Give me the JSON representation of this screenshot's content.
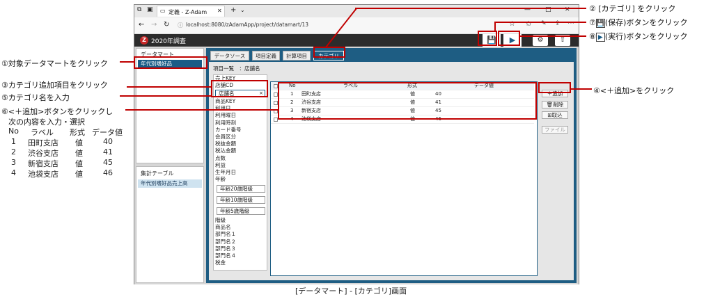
{
  "browser": {
    "tab_title": "定義 - Z-Adam",
    "url": "localhost:8080/zAdamApp/project/datamart/13"
  },
  "app": {
    "title": "2020年調査"
  },
  "sidebar": {
    "header": "データマート",
    "items": [
      "年代別嗜好品"
    ],
    "table_header": "集計テーブル",
    "table_items": [
      "年代別嗜好品売上高"
    ]
  },
  "tabs": [
    "データソース",
    "項目定義",
    "計算項目",
    "カテゴリ"
  ],
  "item_list": {
    "header": "項目一覧　：店舗名",
    "items": [
      "売上KEY",
      "店舗CD"
    ],
    "input_value": "店舗名",
    "items_after": [
      "商品KEY",
      "利用日",
      "利用曜日",
      "利用時刻",
      "カード番号",
      "会員区分",
      "税抜金額",
      "税込金額",
      "点数",
      "利益",
      "生年月日",
      "年齢"
    ],
    "sub_items": [
      "年齢20歳階級",
      "年齢10歳階級",
      "年齢5歳階級"
    ],
    "items_tail": [
      "階級",
      "商品名",
      "部門名１",
      "部門名２",
      "部門名３",
      "部門名４",
      "税金"
    ]
  },
  "grid": {
    "columns": [
      "No",
      "ラベル",
      "形式",
      "データ値"
    ],
    "rows": [
      {
        "no": "1",
        "label": "田町支店",
        "type": "値",
        "value": "40"
      },
      {
        "no": "2",
        "label": "渋谷支店",
        "type": "値",
        "value": "41"
      },
      {
        "no": "3",
        "label": "新宿支店",
        "type": "値",
        "value": "45"
      },
      {
        "no": "4",
        "label": "池袋支店",
        "type": "値",
        "value": "46"
      }
    ]
  },
  "buttons": {
    "add": "追加",
    "delete": "削除",
    "import": "取込",
    "file": "ファイル"
  },
  "callouts": {
    "c1": "①対象データマートをクリック",
    "c2": "② [カテゴリ] をクリック",
    "c3": "③カテゴリ追加項目をクリック",
    "c4": "④<＋追加>をクリック",
    "c5": "⑤カテゴリ名を入力",
    "c6a": "⑥<＋追加>ボタンをクリックし",
    "c6b": "次の内容を入力・選択",
    "c7_pre": "⑦",
    "c7_post": "(保存)ボタンをクリック",
    "c8_pre": "⑧",
    "c8_post": "(実行)ボタンをクリック"
  },
  "note_table": {
    "headers": [
      "No",
      "ラベル",
      "形式",
      "データ値"
    ],
    "rows": [
      [
        "1",
        "田町支店",
        "値",
        "40"
      ],
      [
        "2",
        "渋谷支店",
        "値",
        "41"
      ],
      [
        "3",
        "新宿支店",
        "値",
        "45"
      ],
      [
        "4",
        "池袋支店",
        "値",
        "46"
      ]
    ]
  },
  "caption": "[データマート] - [カテゴリ]画面"
}
